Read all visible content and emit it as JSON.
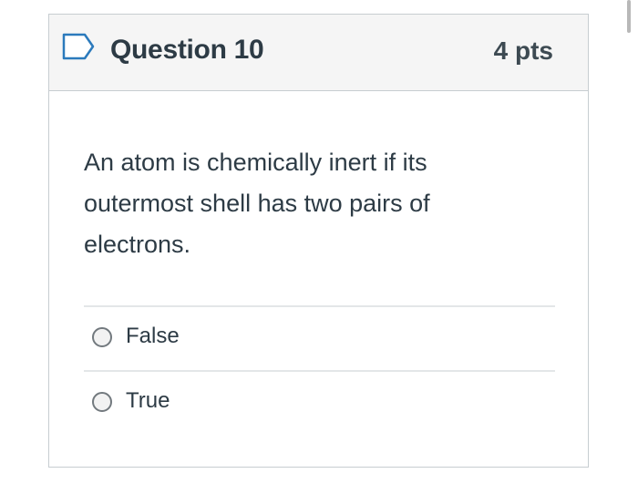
{
  "question": {
    "title": "Question 10",
    "points": "4 pts",
    "text": "An atom is chemically inert if its outermost shell has two pairs of electrons.",
    "flag_icon": "flag-outline-icon",
    "answers": [
      {
        "label": "False",
        "selected": false
      },
      {
        "label": "True",
        "selected": false
      }
    ]
  },
  "colors": {
    "text": "#2d3b45",
    "header_bg": "#f5f5f5",
    "border": "#c7cdd1",
    "flag_stroke": "#2b7abc"
  }
}
